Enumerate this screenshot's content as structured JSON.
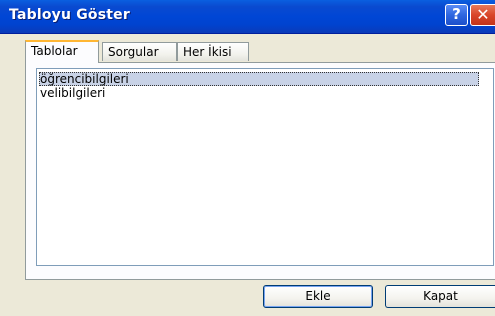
{
  "window": {
    "title": "Tabloyu Göster",
    "help_label": "?",
    "close_label": "✕"
  },
  "tabs": [
    {
      "label": "Tablolar",
      "active": true
    },
    {
      "label": "Sorgular",
      "active": false
    },
    {
      "label": "Her İkisi",
      "active": false
    }
  ],
  "list": {
    "items": [
      {
        "label": "öğrencibilgileri",
        "selected": true
      },
      {
        "label": "velibilgileri",
        "selected": false
      }
    ]
  },
  "buttons": {
    "add_label": "Ekle",
    "close_label": "Kapat"
  },
  "colors": {
    "titlebar": "#0046d5",
    "active_tab_accent": "#ffb633",
    "selection": "#c8d2e6",
    "dialog_bg": "#ece9d8"
  }
}
